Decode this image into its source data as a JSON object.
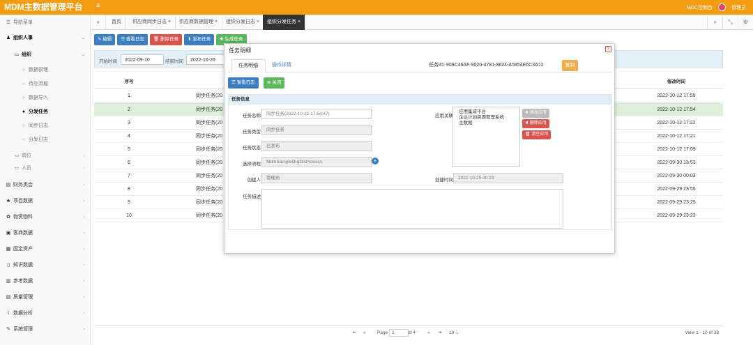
{
  "app": {
    "title": "MDM主数据管理平台",
    "console": "MDC控制台",
    "user": "管理员"
  },
  "sidebar": {
    "header": "导航菜单",
    "items": [
      {
        "label": "组织人事",
        "level": 0,
        "bold": true
      },
      {
        "label": "组织",
        "level": 1,
        "bold": true
      },
      {
        "label": "数据管理",
        "level": 2
      },
      {
        "label": "待办流程",
        "level": 2
      },
      {
        "label": "数据导入",
        "level": 2
      },
      {
        "label": "分发任务",
        "level": 2,
        "active": true
      },
      {
        "label": "同步日志",
        "level": 2
      },
      {
        "label": "分发日志",
        "level": 2
      },
      {
        "label": "岗位",
        "level": 1
      },
      {
        "label": "人员",
        "level": 1
      },
      {
        "label": "财务类会",
        "level": 0
      },
      {
        "label": "项目数据",
        "level": 0
      },
      {
        "label": "物资物料",
        "level": 0
      },
      {
        "label": "客商数据",
        "level": 0
      },
      {
        "label": "固定资产",
        "level": 0
      },
      {
        "label": "知识数据",
        "level": 0
      },
      {
        "label": "参考数据",
        "level": 0
      },
      {
        "label": "质量管理",
        "level": 0
      },
      {
        "label": "数据分析",
        "level": 0
      },
      {
        "label": "系统管理",
        "level": 0
      }
    ]
  },
  "tabs": [
    {
      "label": "首页"
    },
    {
      "label": "供应商同步日志 ×"
    },
    {
      "label": "供应商数据管理 ×"
    },
    {
      "label": "组织分发日志 ×"
    },
    {
      "label": "组织分发任务 ×",
      "active": true
    }
  ],
  "toolbar": {
    "edit": "编辑",
    "view_log": "查看日志",
    "delete": "删除任务",
    "release": "发布任务",
    "generate": "生成任务"
  },
  "filter": {
    "start_label": "开始时间",
    "start_value": "2022-09-10",
    "end_label": "结束时间",
    "end_value": "2022-10-26"
  },
  "grid": {
    "headers": {
      "no": "序号",
      "modified": "修改时间"
    },
    "rows": [
      {
        "no": "1",
        "name": "同步任务(20",
        "modified": "2022-10-12 17:59"
      },
      {
        "no": "2",
        "name": "同步任务(20",
        "modified": "2022-10-12 17:54",
        "selected": true
      },
      {
        "no": "3",
        "name": "同步任务(20",
        "modified": "2022-10-12 17:22"
      },
      {
        "no": "4",
        "name": "同步任务(20",
        "modified": "2022-10-12 17:21"
      },
      {
        "no": "5",
        "name": "同步任务(20",
        "modified": "2022-10-12 17:09"
      },
      {
        "no": "6",
        "name": "同步任务(20",
        "modified": "2022-09-30 13:53"
      },
      {
        "no": "7",
        "name": "同步任务(20",
        "modified": "2022-09-30 00:03"
      },
      {
        "no": "8",
        "name": "同步任务(20",
        "modified": "2022-09-29 23:55"
      },
      {
        "no": "9",
        "name": "同步任务(20",
        "modified": "2022-09-29 23:25"
      },
      {
        "no": "10",
        "name": "同步任务(20",
        "modified": "2022-09-29 23:23"
      }
    ]
  },
  "pager": {
    "page_label": "Page",
    "page": "1",
    "of": "of 4",
    "size": "10",
    "view": "View 1 - 10 of 38"
  },
  "modal": {
    "title": "任务明细",
    "tab_detail": "任务明细",
    "tab_ops": "操作详情",
    "task_id": "任务ID:  909C46AF-9020-4781-8624-A5854E6C3A12",
    "copy": "复制",
    "view_log": "查看日志",
    "close": "关闭",
    "section": "任务信息",
    "fields": {
      "name_label": "任务名称",
      "name": "同步任务(2022-10-12 17:54:47)",
      "type_label": "任务类型",
      "type": "同步任务",
      "status_label": "任务状态",
      "status": "已发布",
      "process_label": "选择流程",
      "process": "MdmSampleOrgDisProcess",
      "creator_label": "创建人",
      "creator": "管理员",
      "apps_label": "应用关联",
      "apps": [
        "应用集成平台",
        "企业计划资源管理系统",
        "主数据"
      ],
      "add_app": "添加应用",
      "del_app": "删除应用",
      "clear_app": "清空应用",
      "created_label": "创建时间",
      "created": "2022-10-25 20:23",
      "desc_label": "任务描述"
    }
  }
}
